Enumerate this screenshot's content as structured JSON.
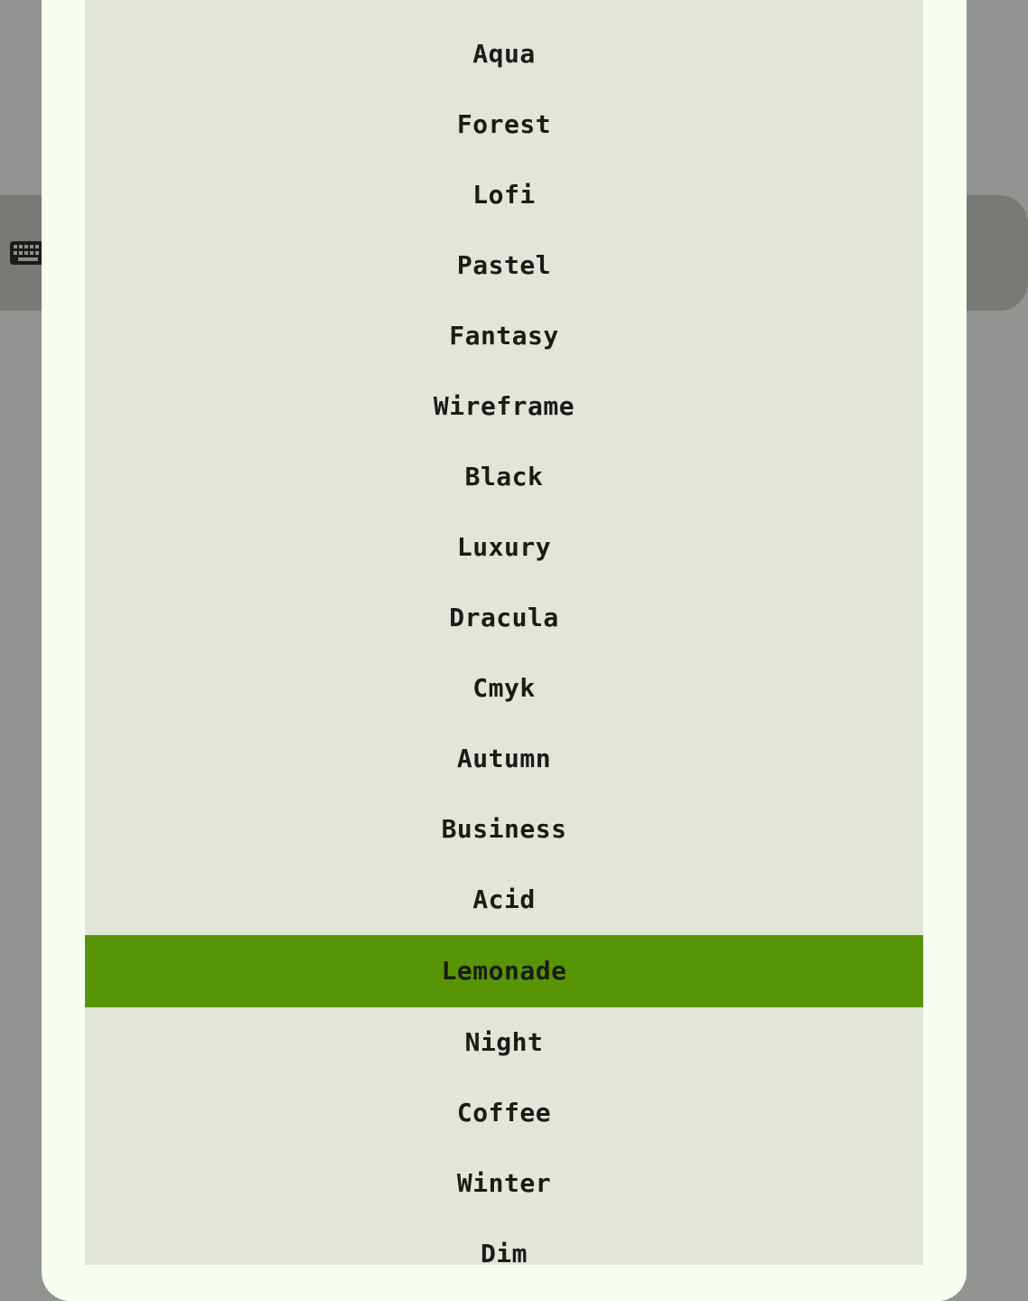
{
  "background": {
    "keyboard_icon": "keyboard-icon"
  },
  "theme_list": {
    "selected": "Lemonade",
    "accent_color": "#589506",
    "items": [
      {
        "label": "Aqua"
      },
      {
        "label": "Forest"
      },
      {
        "label": "Lofi"
      },
      {
        "label": "Pastel"
      },
      {
        "label": "Fantasy"
      },
      {
        "label": "Wireframe"
      },
      {
        "label": "Black"
      },
      {
        "label": "Luxury"
      },
      {
        "label": "Dracula"
      },
      {
        "label": "Cmyk"
      },
      {
        "label": "Autumn"
      },
      {
        "label": "Business"
      },
      {
        "label": "Acid"
      },
      {
        "label": "Lemonade"
      },
      {
        "label": "Night"
      },
      {
        "label": "Coffee"
      },
      {
        "label": "Winter"
      },
      {
        "label": "Dim"
      }
    ]
  }
}
